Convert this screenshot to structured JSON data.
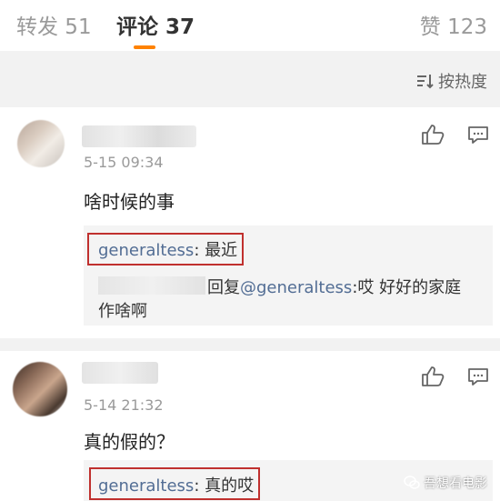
{
  "tabs": {
    "repost": "转发 51",
    "comments": "评论 37",
    "likes": "赞 123"
  },
  "sort": {
    "label": "按热度",
    "icon": "sort-icon"
  },
  "comments": [
    {
      "time": "5-15 09:34",
      "text": "啥时候的事",
      "reply_handle": "generaltess",
      "reply_text": ": 最近",
      "subreply_prefix": "回复",
      "subreply_handle": "@generaltess",
      "subreply_text_1": ":哎 好好的家庭",
      "subreply_text_2": "作啥啊"
    },
    {
      "time": "5-14 21:32",
      "text": "真的假的？",
      "reply_handle": "generaltess",
      "reply_text": ": 真的哎"
    }
  ],
  "watermark": "吾想看电影",
  "colors": {
    "accent": "#ff8200",
    "link": "#526d94",
    "highlight_box": "#c0302e"
  }
}
